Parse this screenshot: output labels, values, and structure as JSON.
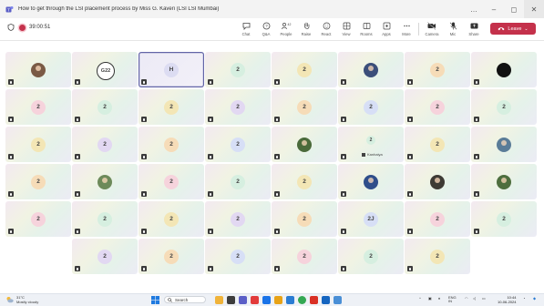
{
  "window": {
    "title": "How to get through the LSI placement process by Miss G. Kaveri (LSI LSI Mumbai)",
    "controls": [
      "…",
      "–",
      "◻",
      "✕"
    ]
  },
  "meeting": {
    "timer": "39:00:51",
    "toolbar": [
      {
        "label": "Chat",
        "icon": "chat-icon"
      },
      {
        "label": "Q&A",
        "icon": "qa-icon"
      },
      {
        "label": "People",
        "icon": "people-icon",
        "badge": "42"
      },
      {
        "label": "Raise",
        "icon": "raise-hand-icon"
      },
      {
        "label": "React",
        "icon": "react-icon"
      },
      {
        "label": "View",
        "icon": "view-icon"
      },
      {
        "label": "Rooms",
        "icon": "rooms-icon"
      },
      {
        "label": "Apps",
        "icon": "apps-icon"
      },
      {
        "label": "More",
        "icon": "more-icon"
      },
      {
        "label": "Camera",
        "icon": "camera-icon"
      },
      {
        "label": "Mic",
        "icon": "mic-icon"
      },
      {
        "label": "Share",
        "icon": "share-icon"
      }
    ],
    "leave_label": "Leave"
  },
  "participants": [
    {
      "kind": "photo",
      "fill": "#7a5a45"
    },
    {
      "kind": "badge",
      "label": "G22"
    },
    {
      "kind": "initial",
      "label": "H",
      "selected": true
    },
    {
      "kind": "initial",
      "label": "2"
    },
    {
      "kind": "initial",
      "label": "2"
    },
    {
      "kind": "photo",
      "fill": "#3b4e7a"
    },
    {
      "kind": "initial",
      "label": "2"
    },
    {
      "kind": "photo",
      "fill": "#111111"
    },
    {
      "kind": "initial",
      "label": "2"
    },
    {
      "kind": "initial",
      "label": "2"
    },
    {
      "kind": "initial",
      "label": "2"
    },
    {
      "kind": "initial",
      "label": "2"
    },
    {
      "kind": "initial",
      "label": "2"
    },
    {
      "kind": "initial",
      "label": "2"
    },
    {
      "kind": "initial",
      "label": "2"
    },
    {
      "kind": "initial",
      "label": "2"
    },
    {
      "kind": "initial",
      "label": "2"
    },
    {
      "kind": "initial",
      "label": "2"
    },
    {
      "kind": "initial",
      "label": "2"
    },
    {
      "kind": "initial",
      "label": "2"
    },
    {
      "kind": "photo",
      "fill": "#4a6a3a"
    },
    {
      "kind": "initial",
      "label": "2",
      "name": "Kanhaiya"
    },
    {
      "kind": "initial",
      "label": "2"
    },
    {
      "kind": "photo",
      "fill": "#5a7c98"
    },
    {
      "kind": "initial",
      "label": "2"
    },
    {
      "kind": "photo",
      "fill": "#6d8a5a"
    },
    {
      "kind": "initial",
      "label": "2"
    },
    {
      "kind": "initial",
      "label": "2"
    },
    {
      "kind": "initial",
      "label": "2"
    },
    {
      "kind": "photo",
      "fill": "#2f4e8a"
    },
    {
      "kind": "photo",
      "fill": "#3e3a34"
    },
    {
      "kind": "photo",
      "fill": "#4e6e3e"
    },
    {
      "kind": "initial",
      "label": "2"
    },
    {
      "kind": "initial",
      "label": "2"
    },
    {
      "kind": "initial",
      "label": "2"
    },
    {
      "kind": "initial",
      "label": "2"
    },
    {
      "kind": "initial",
      "label": "2"
    },
    {
      "kind": "initial",
      "label": "2J"
    },
    {
      "kind": "initial",
      "label": "2"
    },
    {
      "kind": "initial",
      "label": "2"
    },
    {
      "kind": "empty"
    },
    {
      "kind": "initial",
      "label": "2"
    },
    {
      "kind": "initial",
      "label": "2"
    },
    {
      "kind": "initial",
      "label": "2"
    },
    {
      "kind": "initial",
      "label": "2"
    },
    {
      "kind": "initial",
      "label": "2"
    },
    {
      "kind": "initial",
      "label": "2"
    },
    {
      "kind": "empty"
    }
  ],
  "avatar_palette": [
    "#f6dcb8",
    "#d7dff6",
    "#f6d3dc",
    "#d6efe0",
    "#f3e6b5",
    "#e2d8f2"
  ],
  "taskbar": {
    "weather_temp": "31°C",
    "weather_desc": "Mostly cloudy",
    "search_placeholder": "Search",
    "lang": "ENG",
    "lang_sub": "IN",
    "time": "10:44",
    "date": "10-06-2024"
  }
}
